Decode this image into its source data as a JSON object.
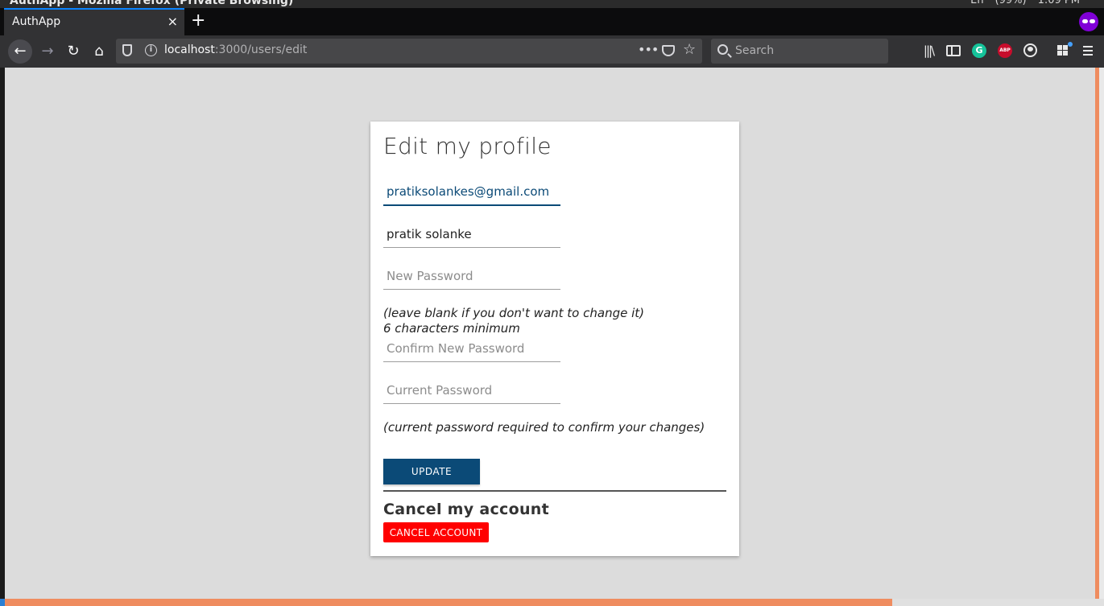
{
  "os": {
    "window_title": "AuthApp - Mozilla Firefox (Private Browsing)",
    "tray_language": "En",
    "tray_battery": "(99%)",
    "tray_time": "1:09 PM"
  },
  "browser": {
    "tab_title": "AuthApp",
    "tab_close": "×",
    "new_tab": "+",
    "url_host": "localhost",
    "url_rest": ":3000/users/edit",
    "url_dots": "•••",
    "star": "☆",
    "search_placeholder": "Search",
    "back": "←",
    "forward": "→",
    "reload": "↻",
    "home": "⌂",
    "library": "|||\\",
    "grammarly": "G",
    "abp": "ABP"
  },
  "form": {
    "title": "Edit my profile",
    "email_value": "pratiksolankes@gmail.com",
    "name_value": "pratik solanke",
    "new_password_placeholder": "New Password",
    "hint_leave_blank": "(leave blank if you don't want to change it)",
    "hint_min_chars": "6 characters minimum",
    "confirm_password_placeholder": "Confirm New Password",
    "current_password_placeholder": "Current Password",
    "hint_current_required": "(current password required to confirm your changes)",
    "update_label": "UPDATE",
    "cancel_heading": "Cancel my account",
    "cancel_label": "CANCEL ACCOUNT"
  },
  "colors": {
    "primary": "#0b4a77",
    "danger": "#ff0000",
    "accent_strip": "#ef8c5f",
    "private_badge": "#8000d7"
  }
}
